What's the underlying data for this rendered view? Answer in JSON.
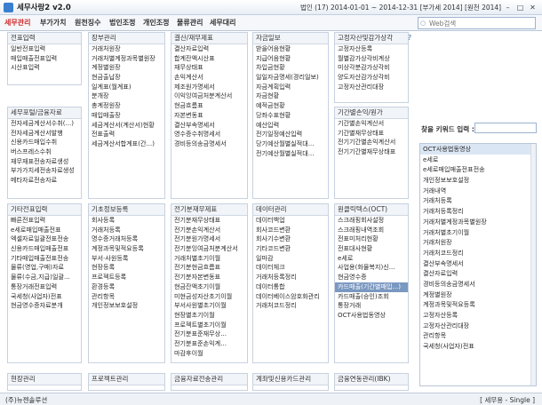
{
  "window": {
    "title": "세무사랑2 v2.0",
    "period": "법인 (17) 2014-01-01 ~ 2014-12-31 [부가세 2014] [원천 2014]"
  },
  "menu": [
    {
      "label": "세무관리",
      "active": true
    },
    {
      "label": "부가가치",
      "active": false
    },
    {
      "label": "원천징수",
      "active": false
    },
    {
      "label": "법인조정",
      "active": false
    },
    {
      "label": "개인조정",
      "active": false
    },
    {
      "label": "물류관리",
      "active": false
    },
    {
      "label": "세무대리",
      "active": false
    }
  ],
  "search": {
    "placeholder": "Web검색"
  },
  "panels": [
    {
      "title": "전표입력",
      "items": [
        "일반전표입력",
        "매입매출전표입력",
        "시산표입력"
      ]
    },
    {
      "title": "장부관리",
      "items": [
        "거래처원장",
        "거래처별계정과목별원장",
        "계정별원장",
        "현금출납장",
        "일계표(월계표)",
        "분개장",
        "총계정원장",
        "매입매출장",
        "세금계산서(계산서)현황",
        "전표출력",
        "세금계산서합계표(간...)"
      ]
    },
    {
      "title": "결산/재무제표",
      "items": [
        "결산자료입력",
        "합계잔액시산표",
        "재무상태표",
        "손익계산서",
        "제조원가명세서",
        "이익잉여금처분계산서",
        "현금흐름표",
        "자본변동표",
        "결산부속명세서",
        "영수증수취명세서",
        "경비등의송금명세서"
      ]
    },
    {
      "title": "자금일보",
      "items": [
        "받을어음현황",
        "지급어음현황",
        "차입금현황",
        "일일자금명세(경리일보)",
        "자금계획입력",
        "자금현황",
        "예적금현황",
        "당좌수표현황",
        "예산입력",
        "전기일정예산입력",
        "당기예산월별실적대...",
        "전기예산월별실적대..."
      ]
    },
    {
      "title": "고정자산및감가상각",
      "items": [
        "고정자산등록",
        "월별감가상각비계상",
        "미상각분감가상각비",
        "양도자산감가상각비",
        "고정자산관리대장"
      ]
    },
    {
      "title": "세무포털/금융자료",
      "items": [
        "전자세금계산서수취(...)",
        "전자세금계산서발행",
        "신용카드매입수취",
        "버스프레스수취",
        "재무재표전송자료생성",
        "부가가치세전송자료생성",
        "메타자료전송자료"
      ]
    },
    {
      "title": "기간별손익/원가",
      "items": [
        "기간별손익계산서",
        "기간별재무상태표",
        "전기기간별손익계산서",
        "전기기간별재무상태표"
      ]
    },
    {
      "title": "기타전표입력",
      "items": [
        "빠른전표입력",
        "e세로매입매출전표",
        "엑셀자료일괄전표전송",
        "신용카드매입매출전표",
        "기타매입매출전표전송",
        "물류(영업,구매)자료",
        "물류(수금,지급)일괄...",
        "통장거래전표입력",
        "국세청(사업자)전표",
        "현금영수증자료분개"
      ]
    },
    {
      "title": "기초정보등록",
      "items": [
        "회사등록",
        "거래처등록",
        "명수증거래처등록",
        "계정과목및적요등록",
        "부서·사원등록",
        "현장등록",
        "프로젝트등록",
        "환경등록",
        "관리항목",
        "개인정보보호설정"
      ]
    },
    {
      "title": "전기분재무제표",
      "items": [
        "전기분재무상태표",
        "전기분손익계산서",
        "전기분원가명세서",
        "전기분잉여금처분계산서",
        "거래처별초기이월",
        "전기분현금흐름표",
        "전기분자본변동표",
        "현금잔액초기이월",
        "미현금성자산초기이월",
        "부서사원별초기이월",
        "현장별초기이월",
        "프로젝트별초기이월",
        "전기분표준재무상...",
        "전기분표준손익계...",
        "마감후이월"
      ]
    },
    {
      "title": "데이터관리",
      "items": [
        "데이터백업",
        "회사코드변환",
        "회사기수변환",
        "기타코드변환",
        "일마감",
        "데이터체크",
        "거래처등록정리",
        "데이터통합",
        "데이터베이스암호화관리",
        "거래처코드정리"
      ]
    },
    {
      "title": "원클릭텍스(OCT)",
      "items": [
        "스크래핑회사설정",
        "스크래핑내역조회",
        "전표미처리현황",
        "전표대사현황",
        "e세로",
        "사업용(화물복지)신...",
        "현금영수증",
        "카드매출(기간별매입...)",
        "카드매출(승인)조회",
        "통장거래",
        "OCT사용법동영상"
      ]
    },
    {
      "title": "현장관리",
      "items": []
    },
    {
      "title": "프로젝트관리",
      "items": []
    },
    {
      "title": "금융자료전송관리",
      "items": []
    },
    {
      "title": "계좌및신용카드관리",
      "items": []
    },
    {
      "title": "금융연동관리(IBK)",
      "items": []
    }
  ],
  "keyword": {
    "label": "찾을 키워드 입력 :",
    "items": [
      "OCT사용법동영상",
      "e세로",
      "e세로매입매출전표전송",
      "개인정보보호설정",
      "거래내역",
      "거래처등록",
      "거래처등록정리",
      "거래처별계정과목별원장",
      "거래처별초기이월",
      "거래처원장",
      "거래처코드정리",
      "결산부속명세서",
      "결산자료입력",
      "경비등의송금명세서",
      "계정별원장",
      "계정과목및적요등록",
      "고정자산등록",
      "고정자산관리대장",
      "관리항목",
      "국세청(사업자)전표"
    ]
  },
  "status": {
    "company": "(주)뉴젠솔루션",
    "mode": "[ 세무용 - Single ]"
  }
}
